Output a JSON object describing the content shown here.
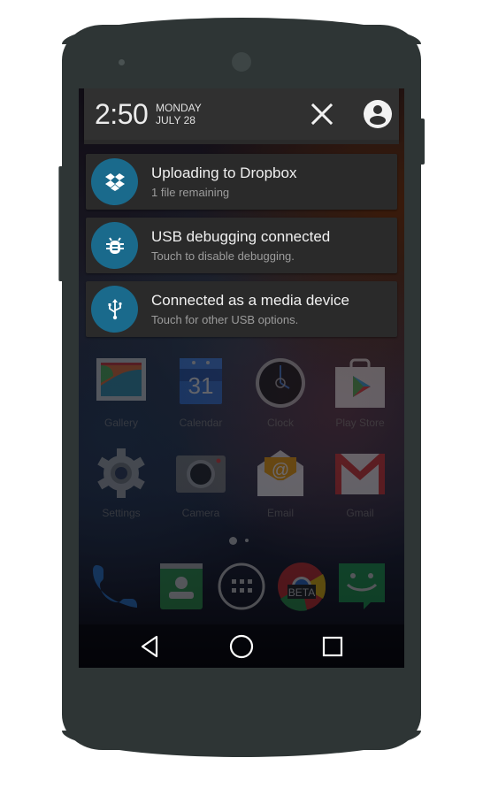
{
  "status_header": {
    "time": "2:50",
    "day": "MONDAY",
    "date": "JULY 28",
    "close_icon": "close-icon",
    "user_icon": "account-circle-icon"
  },
  "notifications": [
    {
      "title": "Uploading to Dropbox",
      "subtitle": "1 file remaining",
      "icon": "dropbox-icon",
      "icon_bg": "#1a6a8c"
    },
    {
      "title": "USB debugging connected",
      "subtitle": "Touch to disable debugging.",
      "icon": "bug-icon",
      "icon_bg": "#1a6a8c"
    },
    {
      "title": "Connected as a media device",
      "subtitle": "Touch for other USB options.",
      "icon": "usb-icon",
      "icon_bg": "#1a6a8c"
    }
  ],
  "home_apps": {
    "row1": [
      {
        "label": "Gallery",
        "icon": "gallery-icon"
      },
      {
        "label": "Calendar",
        "icon": "calendar-icon",
        "calendar_day": "31"
      },
      {
        "label": "Clock",
        "icon": "clock-icon"
      },
      {
        "label": "Play Store",
        "icon": "play-store-icon"
      }
    ],
    "row2": [
      {
        "label": "Settings",
        "icon": "settings-icon"
      },
      {
        "label": "Camera",
        "icon": "camera-icon"
      },
      {
        "label": "Email",
        "icon": "email-icon"
      },
      {
        "label": "Gmail",
        "icon": "gmail-icon"
      }
    ]
  },
  "dock": [
    {
      "name": "phone",
      "icon": "phone-icon"
    },
    {
      "name": "contacts",
      "icon": "contacts-icon"
    },
    {
      "name": "app-drawer",
      "icon": "app-drawer-icon"
    },
    {
      "name": "chrome-beta",
      "icon": "chrome-beta-icon",
      "badge": "BETA"
    },
    {
      "name": "messenger",
      "icon": "messenger-icon"
    }
  ],
  "page_indicator": {
    "pages": 2,
    "current": 1
  },
  "nav_bar": {
    "back": "back-icon",
    "home": "home-icon",
    "recents": "recents-icon"
  },
  "colors": {
    "accent": "#1a6a8c",
    "phone_body": "#2e3535",
    "panel": "#303030"
  }
}
